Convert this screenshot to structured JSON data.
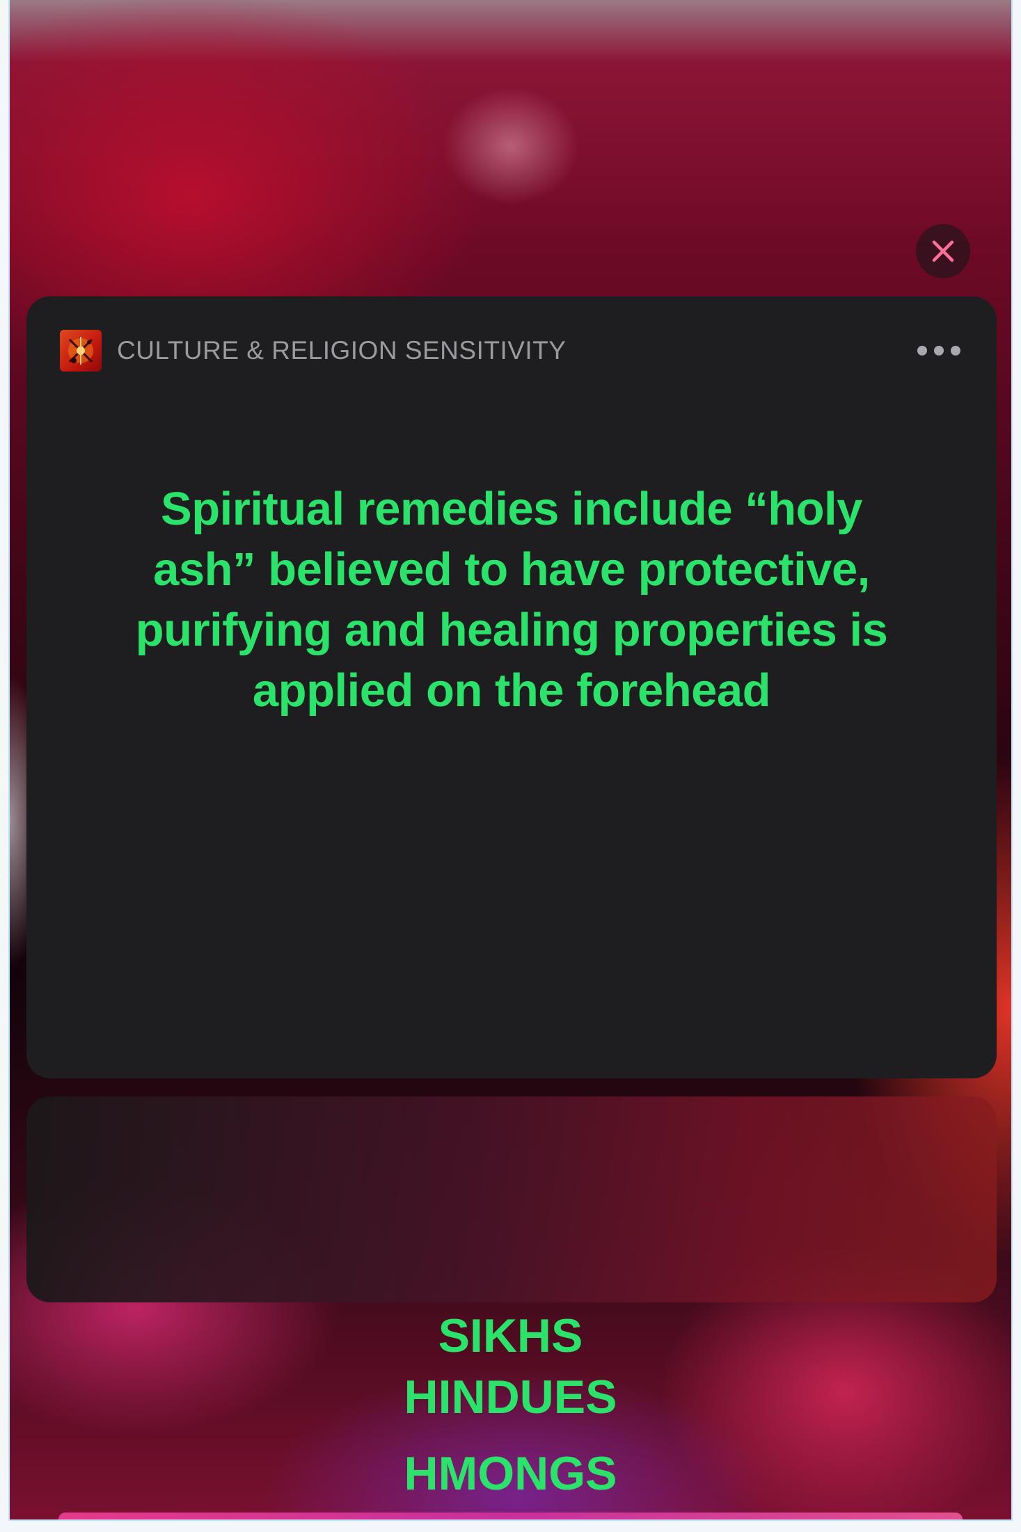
{
  "notification": {
    "app_name": "CULTURE & RELIGION SENSITIVITY",
    "app_icon": "app-logo-icon",
    "more_icon": "more-dots-icon",
    "close_icon": "close-icon",
    "message": "Spiritual remedies include “holy ash” believed to have protective, purifying and healing properties is applied on the forehead"
  },
  "answers": [
    "SIKHS",
    "HINDUES",
    "HMONGS"
  ],
  "colors": {
    "accent_text": "#2be26a",
    "card_background": "#1e1e20",
    "close_x": "#ff6f9a"
  }
}
